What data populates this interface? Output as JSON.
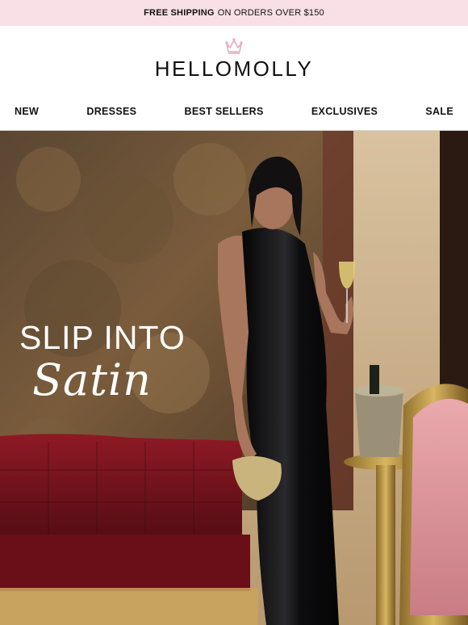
{
  "promo": {
    "bold": "FREE SHIPPING",
    "rest": "ON ORDERS OVER $150"
  },
  "brand": {
    "name": "HELLOMOLLY",
    "icon": "crown-icon",
    "crown_color": "#e8a9bd"
  },
  "nav": {
    "items": [
      {
        "label": "NEW"
      },
      {
        "label": "DRESSES"
      },
      {
        "label": "BEST SELLERS"
      },
      {
        "label": "EXCLUSIVES"
      },
      {
        "label": "SALE"
      }
    ]
  },
  "hero": {
    "line1": "SLIP INTO",
    "line2": "Satin"
  },
  "colors": {
    "promo_bg": "#f9dfe6",
    "sofa": "#7d1520",
    "dress": "#0b0b0d"
  }
}
